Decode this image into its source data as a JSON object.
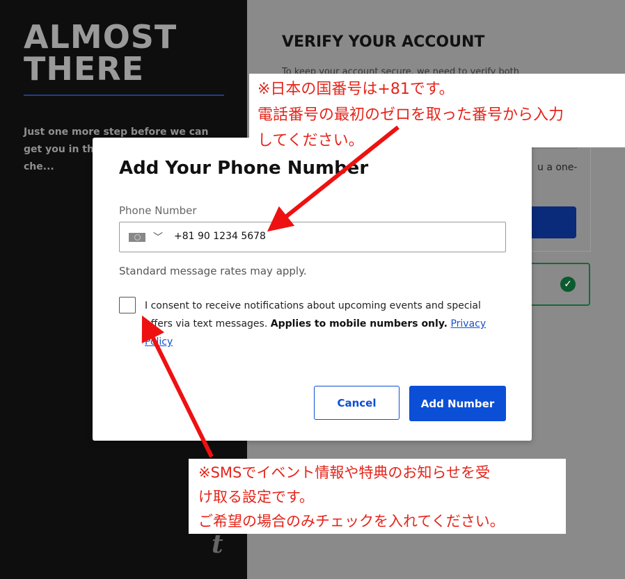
{
  "sidebar": {
    "hero_line1": "ALMOST",
    "hero_line2": "THERE",
    "intro": "Just one more step before we can get you in the digital e... bouncer che...",
    "brand_mark": "t"
  },
  "background": {
    "title": "VERIFY YOUR ACCOUNT",
    "subtitle": "To keep your account secure, we need to verify both",
    "card_text": "u a one-"
  },
  "modal": {
    "title": "Add Your Phone Number",
    "phone_label": "Phone Number",
    "phone_value": "+81 90 1234 5678",
    "rates_text": "Standard message rates may apply.",
    "consent_text": "I consent to receive notifications about upcoming events and special offers via text messages.",
    "consent_bold": "Applies to mobile numbers only.",
    "privacy_link": "Privacy Policy",
    "cancel_label": "Cancel",
    "add_label": "Add Number"
  },
  "annotations": {
    "top_line1": "※日本の国番号は+81です。",
    "top_line2": "電話番号の最初のゼロを取った番号から入力",
    "top_line3": "してください。",
    "bottom_line1": "※SMSでイベント情報や特典のお知らせを受",
    "bottom_line2": "け取る設定です。",
    "bottom_line3": "ご希望の場合のみチェックを入れてください。"
  },
  "colors": {
    "accent": "#0b4fd6",
    "annotation_red": "#e5241a"
  }
}
